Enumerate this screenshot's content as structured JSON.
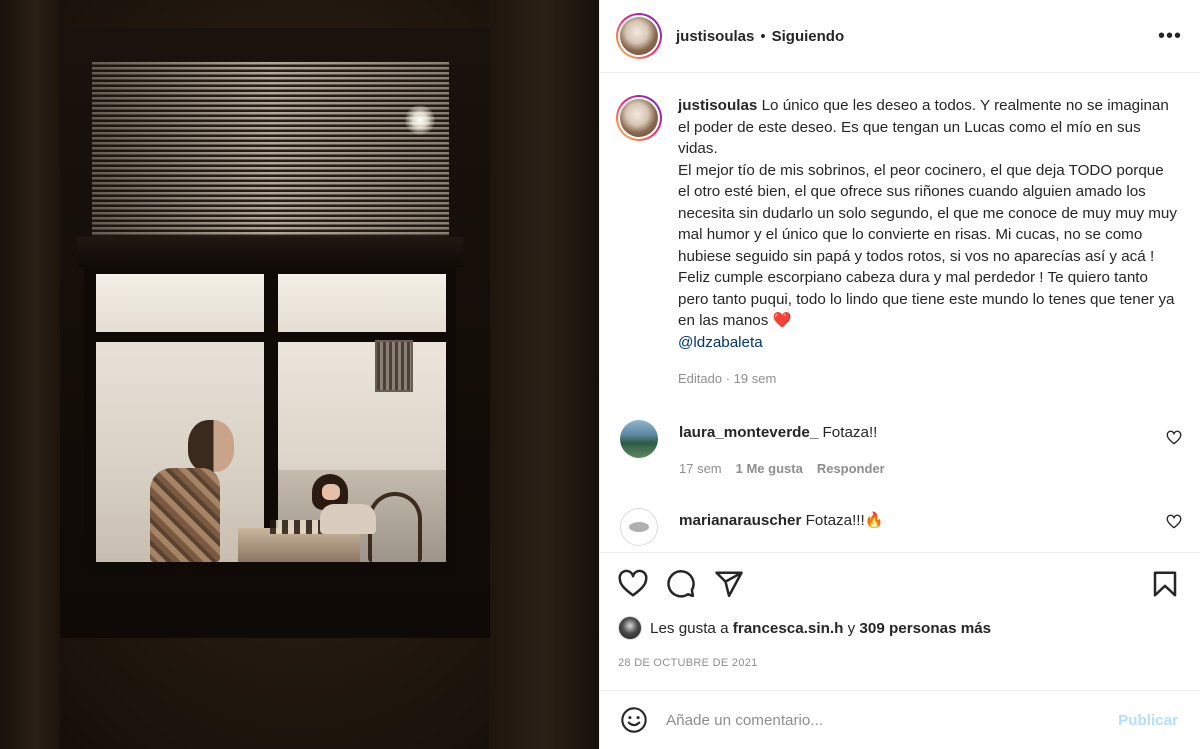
{
  "post": {
    "photo_icon": "window-chess-photo"
  },
  "header": {
    "username": "justisoulas",
    "separator": "•",
    "follow_status": "Siguiendo",
    "more_icon": "more-horizontal-icon",
    "more_label": "•••"
  },
  "caption": {
    "username": "justisoulas",
    "text": "Lo único que les deseo a todos. Y realmente no se imaginan el poder de este deseo. Es que tengan un Lucas como el mío en sus vidas.",
    "text2": "El mejor tío de mis sobrinos, el peor cocinero, el que deja TODO porque el otro esté bien, el que ofrece sus riñones cuando alguien amado los necesita sin dudarlo un solo segundo, el que me conoce de muy muy muy mal humor y el único que lo convierte en risas. Mi cucas, no se como hubiese seguido sin papá y todos rotos, si vos no aparecías así y acá ! Feliz cumple escorpiano cabeza dura y mal perdedor ! Te quiero tanto pero tanto puqui, todo lo lindo que tiene este mundo lo tenes que tener ya en las manos",
    "heart_emoji": "❤️",
    "mention": "@ldzabaleta",
    "edited": "Editado",
    "dot": " · ",
    "age": "19 sem"
  },
  "comments": [
    {
      "username": "laura_monteverde_",
      "text": "Fotaza!!",
      "age": "17 sem",
      "likes": "1 Me gusta",
      "reply": "Responder"
    },
    {
      "username": "marianarauscher",
      "text": "Fotaza!!!🔥"
    }
  ],
  "actions": {
    "like_icon": "heart-icon",
    "comment_icon": "comment-icon",
    "share_icon": "share-icon",
    "save_icon": "bookmark-icon"
  },
  "likes": {
    "prefix": "Les gusta a",
    "first_user": "francesca.sin.h",
    "middle": "y",
    "others": "309 personas más"
  },
  "date": "28 DE OCTUBRE DE 2021",
  "add_comment": {
    "emoji_icon": "emoji-icon",
    "placeholder": "Añade un comentario...",
    "publish": "Publicar"
  },
  "colors": {
    "link": "#00376b",
    "publish_disabled": "#b2dffc",
    "secondary_text": "#8e8e8e",
    "heart_red": "#ed4956"
  }
}
